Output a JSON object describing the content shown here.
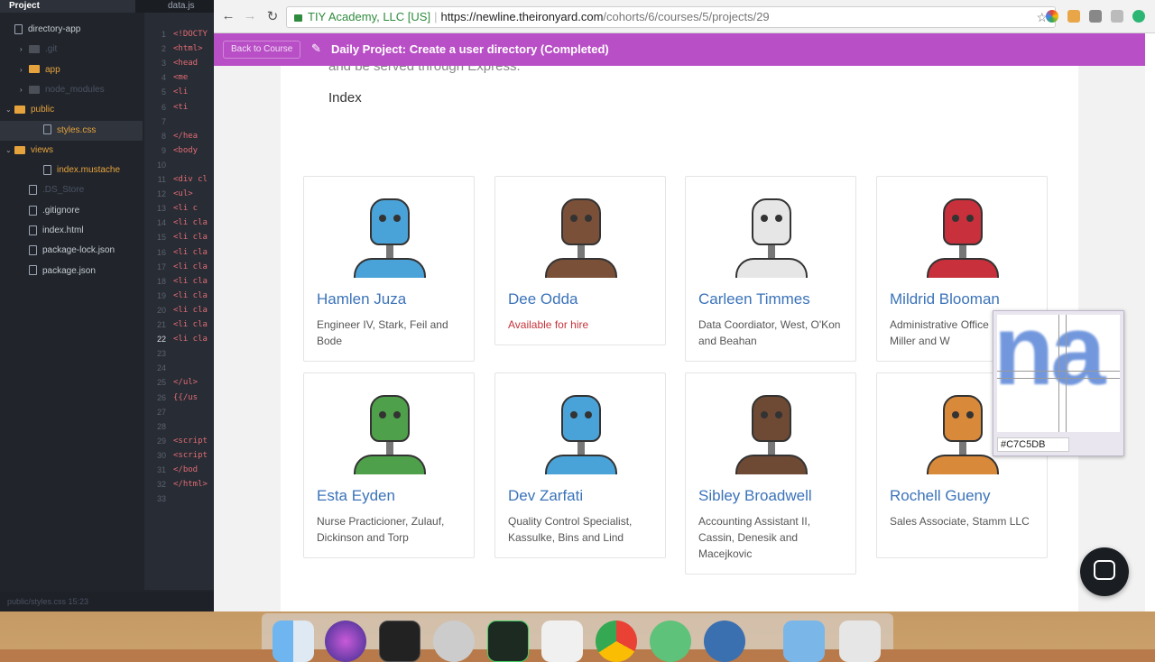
{
  "editor": {
    "tabs": [
      "Project",
      "data.js"
    ],
    "tree": [
      {
        "label": "directory-app",
        "kind": "root"
      },
      {
        "label": ".git",
        "kind": "folder-dim"
      },
      {
        "label": "app",
        "kind": "folder"
      },
      {
        "label": "node_modules",
        "kind": "folder-dim"
      },
      {
        "label": "public",
        "kind": "folder"
      },
      {
        "label": "styles.css",
        "kind": "file-sel"
      },
      {
        "label": "views",
        "kind": "folder"
      },
      {
        "label": "index.mustache",
        "kind": "file-orange"
      },
      {
        "label": ".DS_Store",
        "kind": "file-dim"
      },
      {
        "label": ".gitignore",
        "kind": "file"
      },
      {
        "label": "index.html",
        "kind": "file"
      },
      {
        "label": "package-lock.json",
        "kind": "file"
      },
      {
        "label": "package.json",
        "kind": "file"
      }
    ],
    "line_numbers": [
      "1",
      "2",
      "3",
      "4",
      "5",
      "6",
      "7",
      "8",
      "9",
      "10",
      "11",
      "12",
      "13",
      "14",
      "15",
      "16",
      "17",
      "18",
      "19",
      "20",
      "21",
      "22",
      "23",
      "24",
      "25",
      "26",
      "27",
      "28",
      "29",
      "30",
      "31",
      "32",
      "33"
    ],
    "code_lines": [
      "<!DOCTY",
      "<html>",
      "  <head",
      "    <me",
      "    <li",
      "    <ti",
      "",
      "  </hea",
      "  <body",
      "",
      "<div cl",
      "<ul>",
      "  <li c",
      "<li cla",
      "<li cla",
      "<li cla",
      "<li cla",
      "<li cla",
      "<li cla",
      "<li cla",
      "<li cla",
      "<li cla",
      "",
      "",
      "</ul>",
      "  {{/us",
      "",
      "",
      "<script",
      "<script",
      "  </bod",
      "</html>",
      ""
    ],
    "status": "public/styles.css  15:23"
  },
  "browser": {
    "secure_label": "TIY Academy, LLC [US]",
    "url_host": "https://newline.theironyard.com",
    "url_path": "/cohorts/6/courses/5/projects/29"
  },
  "course": {
    "back_label": "Back to Course",
    "title": "Daily Project: Create a user directory (Completed)"
  },
  "page": {
    "partial_text": "and be served through Express.",
    "heading": "Index",
    "people": [
      {
        "name": "Hamlen Juza",
        "role": "Engineer IV, Stark, Feil and Bode",
        "hire": false,
        "robot_color": "#4aa3d8"
      },
      {
        "name": "Dee Odda",
        "role": "Available for hire",
        "hire": true,
        "robot_color": "#7a5038"
      },
      {
        "name": "Carleen Timmes",
        "role": "Data Coordiator, West, O'Kon and Beahan",
        "hire": false,
        "robot_color": "#e6e6e6"
      },
      {
        "name": "Mildrid Blooman",
        "role": "Administrative Office Kautzer, Miller and W",
        "hire": false,
        "robot_color": "#c8303b"
      },
      {
        "name": "Esta Eyden",
        "role": "Nurse Practicioner, Zulauf, Dickinson and Torp",
        "hire": false,
        "robot_color": "#4fa04a"
      },
      {
        "name": "Dev Zarfati",
        "role": "Quality Control Specialist, Kassulke, Bins and Lind",
        "hire": false,
        "robot_color": "#4aa3d8"
      },
      {
        "name": "Sibley Broadwell",
        "role": "Accounting Assistant II, Cassin, Denesik and Macejkovic",
        "hire": false,
        "robot_color": "#6e4a34"
      },
      {
        "name": "Rochell Gueny",
        "role": "Sales Associate, Stamm LLC",
        "hire": false,
        "robot_color": "#d9893a"
      }
    ]
  },
  "picker": {
    "magnified_text": "na",
    "hex": "#C7C5DB"
  },
  "colors": {
    "accent": "#b94fc6",
    "link": "#3b73b9",
    "hire": "#c6343b"
  }
}
